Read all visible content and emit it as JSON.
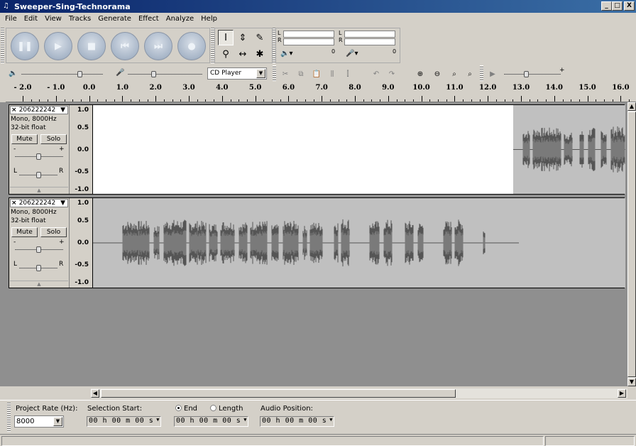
{
  "window": {
    "title": "Sweeper-Sing-Technorama",
    "buttons": {
      "minimize": "_",
      "maximize": "□",
      "close": "X"
    }
  },
  "menu": [
    "File",
    "Edit",
    "View",
    "Tracks",
    "Generate",
    "Effect",
    "Analyze",
    "Help"
  ],
  "transport": {
    "pause": "❚❚",
    "play": "▶",
    "stop": "■",
    "rewind": "⏮",
    "fastforward": "⏭",
    "record": "●"
  },
  "tools": {
    "select": "I",
    "envelope": "⇕",
    "draw": "✎",
    "zoom": "⚲",
    "timeshift": "↔",
    "multi": "✱"
  },
  "meters": {
    "left_channel": "L",
    "right_channel": "R",
    "playback_zero": "0",
    "record_zero": "0"
  },
  "mixer": {
    "output_device": "CD Player",
    "output_level": 0.72,
    "input_level": 0.35,
    "play_at_speed": 0.4,
    "play_at_speed_plus": "+"
  },
  "ruler": {
    "ticks": [
      "- 2.0",
      "- 1.0",
      "0.0",
      "1.0",
      "2.0",
      "3.0",
      "4.0",
      "5.0",
      "6.0",
      "7.0",
      "8.0",
      "9.0",
      "10.0",
      "11.0",
      "12.0",
      "13.0",
      "14.0",
      "15.0",
      "16.0"
    ]
  },
  "tracks": [
    {
      "name": "206222242",
      "format": "Mono, 8000Hz",
      "bitdepth": "32-bit float",
      "mute": "Mute",
      "solo": "Solo",
      "gain_minus": "-",
      "gain_plus": "+",
      "pan_left": "L",
      "pan_right": "R",
      "scale": [
        "1.0",
        "0.5",
        "0.0",
        "-0.5",
        "-1.0"
      ]
    },
    {
      "name": "206222242",
      "format": "Mono, 8000Hz",
      "bitdepth": "32-bit float",
      "mute": "Mute",
      "solo": "Solo",
      "gain_minus": "-",
      "gain_plus": "+",
      "pan_left": "L",
      "pan_right": "R",
      "scale": [
        "1.0",
        "0.5",
        "0.0",
        "-0.5",
        "-1.0"
      ]
    }
  ],
  "selection_bar": {
    "project_rate_label": "Project Rate (Hz):",
    "project_rate_value": "8000",
    "selection_start_label": "Selection Start:",
    "end_label": "End",
    "length_label": "Length",
    "audio_position_label": "Audio Position:",
    "selection_start_value": "00 h 00 m 00 s",
    "end_value": "00 h 00 m 00 s",
    "audio_position_value": "00 h 00 m 00 s"
  },
  "colors": {
    "waveform": "#555555",
    "waveform_rms": "#7a7a7a",
    "track_bg": "#ffffff",
    "track_selected_bg": "#c0c0c0",
    "watermark": "#2aa5b3"
  }
}
